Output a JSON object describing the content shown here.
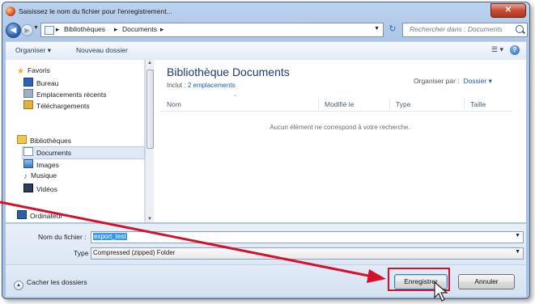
{
  "window": {
    "title": "Saisissez le nom du fichier pour l'enregistrement..."
  },
  "nav": {
    "breadcrumbs": [
      "Bibliothèques",
      "Documents"
    ],
    "search_placeholder": "Rechercher dans : Documents"
  },
  "toolbar": {
    "organize": "Organiser",
    "new_folder": "Nouveau dossier"
  },
  "sidebar": {
    "favorites": "Favoris",
    "desktop": "Bureau",
    "recent": "Emplacements récents",
    "downloads": "Téléchargements",
    "libraries": "Bibliothèques",
    "documents": "Documents",
    "images": "Images",
    "music": "Musique",
    "videos": "Vidéos",
    "computer": "Ordinateur"
  },
  "main": {
    "title": "Bibliothèque Documents",
    "includes_label": "Inclut :",
    "includes_link": "2 emplacements",
    "arrange_label": "Organiser par :",
    "arrange_value": "Dossier",
    "columns": [
      "Nom",
      "Modifié le",
      "Type",
      "Taille"
    ],
    "empty_message": "Aucun élément ne correspond à votre recherche."
  },
  "form": {
    "filename_label": "Nom du fichier :",
    "filename_value": "export_test",
    "type_label": "Type :",
    "type_value": "Compressed (zipped) Folder"
  },
  "footer": {
    "hide_folders": "Cacher les dossiers",
    "save": "Enregistrer",
    "cancel": "Annuler"
  },
  "colors": {
    "highlight": "#d4102a",
    "accent": "#1a5fb4",
    "selection": "#3399ff"
  }
}
